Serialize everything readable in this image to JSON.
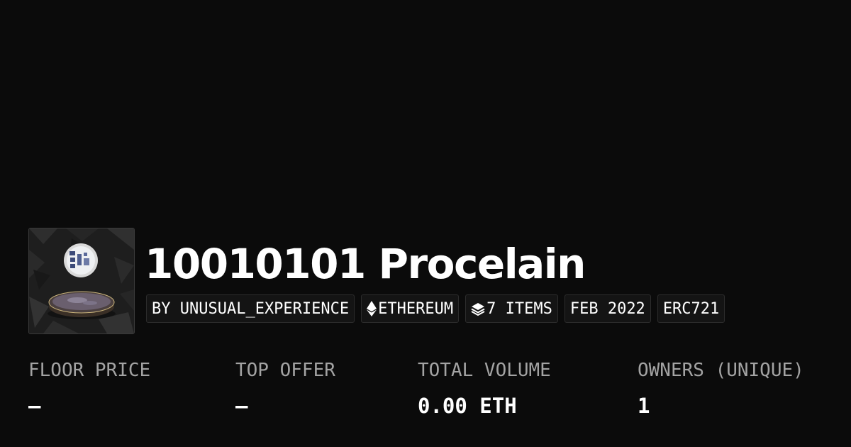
{
  "collection": {
    "title": "10010101 Procelain",
    "thumbnail_icon": "porcelain-plate-image"
  },
  "tags": [
    {
      "label": "BY UNUSUAL_EXPERIENCE",
      "icon": ""
    },
    {
      "label": "ETHEREUM",
      "icon": "ethereum-icon"
    },
    {
      "label": "7 ITEMS",
      "icon": "layers-icon"
    },
    {
      "label": "FEB 2022",
      "icon": ""
    },
    {
      "label": "ERC721",
      "icon": ""
    }
  ],
  "stats": [
    {
      "label": "FLOOR PRICE",
      "value": "–"
    },
    {
      "label": "TOP OFFER",
      "value": "–"
    },
    {
      "label": "TOTAL VOLUME",
      "value": "0.00 ETH"
    },
    {
      "label": "OWNERS (UNIQUE)",
      "value": "1"
    }
  ],
  "colors": {
    "background": "#0b0b0b",
    "tag_background": "#141414",
    "tag_border": "#2c2c2c",
    "label_gray": "#a3a3a3",
    "text": "#ffffff"
  }
}
